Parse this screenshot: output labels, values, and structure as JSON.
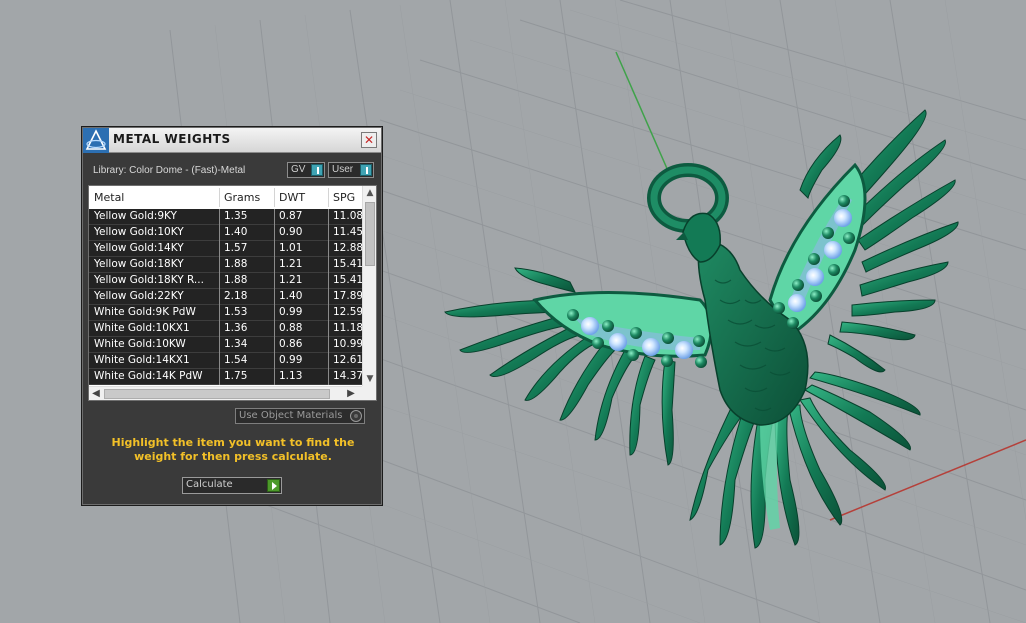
{
  "panel": {
    "title": "METAL WEIGHTS",
    "close_glyph": "✕",
    "icon": "app-logo-icon",
    "library_label": "Library: Color Dome - (Fast)-Metal",
    "view_select": {
      "value": "GV"
    },
    "scope_select": {
      "value": "User"
    },
    "table": {
      "columns": [
        "Metal",
        "Grams",
        "DWT",
        "SPG"
      ],
      "rows": [
        [
          "Yellow Gold:9KY",
          "1.35",
          "0.87",
          "11.08"
        ],
        [
          "Yellow Gold:10KY",
          "1.40",
          "0.90",
          "11.45"
        ],
        [
          "Yellow Gold:14KY",
          "1.57",
          "1.01",
          "12.88"
        ],
        [
          "Yellow Gold:18KY",
          "1.88",
          "1.21",
          "15.41"
        ],
        [
          "Yellow Gold:18KY R...",
          "1.88",
          "1.21",
          "15.41"
        ],
        [
          "Yellow Gold:22KY",
          "2.18",
          "1.40",
          "17.89"
        ],
        [
          "White Gold:9K PdW",
          "1.53",
          "0.99",
          "12.59"
        ],
        [
          "White Gold:10KX1",
          "1.36",
          "0.88",
          "11.18"
        ],
        [
          "White Gold:10KW",
          "1.34",
          "0.86",
          "10.99"
        ],
        [
          "White Gold:14KX1",
          "1.54",
          "0.99",
          "12.61"
        ],
        [
          "White Gold:14K PdW",
          "1.75",
          "1.13",
          "14.37"
        ]
      ],
      "scroll_glyphs": {
        "up": "▲",
        "down": "▼",
        "left": "◀",
        "right": "▶"
      }
    },
    "use_object_materials_label": "Use Object Materials",
    "hint_text": "Highlight the item you want to find the weight for then press calculate.",
    "calculate_label": "Calculate"
  },
  "viewport": {
    "model": "phoenix-pendant",
    "colors": {
      "background": "#a2a6a9",
      "grid": "#8f9397",
      "metal": "#1b8a63",
      "metal_light": "#5fd6a6",
      "gem": "#9fc9f5",
      "axis_y": "#3fa24a",
      "axis_x": "#b5403a"
    }
  }
}
